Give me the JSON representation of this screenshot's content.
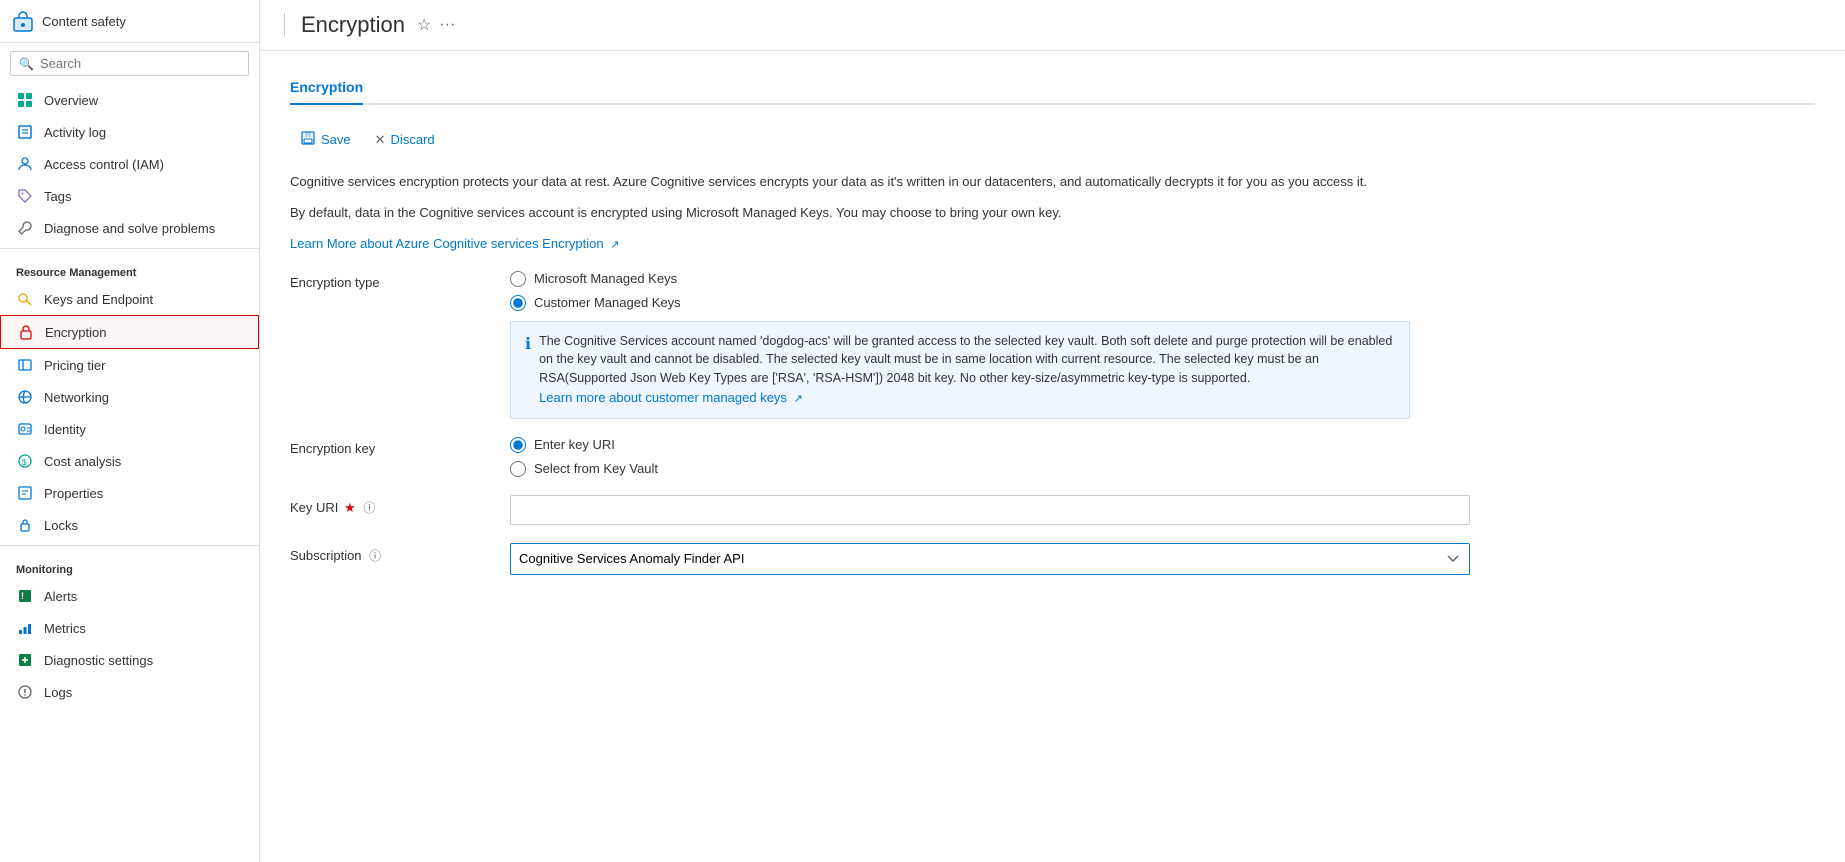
{
  "sidebar": {
    "app_icon_color": "#0078d4",
    "app_name": "Content safety",
    "search_placeholder": "Search",
    "collapse_label": "«",
    "items": [
      {
        "id": "overview",
        "label": "Overview",
        "icon": "grid-icon",
        "icon_color": "#00a693",
        "active": false
      },
      {
        "id": "activity-log",
        "label": "Activity log",
        "icon": "log-icon",
        "icon_color": "#0078d4",
        "active": false
      },
      {
        "id": "access-control",
        "label": "Access control (IAM)",
        "icon": "person-icon",
        "icon_color": "#0078d4",
        "active": false
      },
      {
        "id": "tags",
        "label": "Tags",
        "icon": "tag-icon",
        "icon_color": "#8c6bbf",
        "active": false
      },
      {
        "id": "diagnose",
        "label": "Diagnose and solve problems",
        "icon": "wrench-icon",
        "icon_color": "#666",
        "active": false
      }
    ],
    "sections": [
      {
        "label": "Resource Management",
        "items": [
          {
            "id": "keys-endpoint",
            "label": "Keys and Endpoint",
            "icon": "key-icon",
            "icon_color": "#f0a000",
            "active": false
          },
          {
            "id": "encryption",
            "label": "Encryption",
            "icon": "encryption-icon",
            "icon_color": "#e00000",
            "active": true,
            "highlighted": true
          },
          {
            "id": "pricing-tier",
            "label": "Pricing tier",
            "icon": "pricing-icon",
            "icon_color": "#0078d4",
            "active": false
          },
          {
            "id": "networking",
            "label": "Networking",
            "icon": "network-icon",
            "icon_color": "#0078d4",
            "active": false
          },
          {
            "id": "identity",
            "label": "Identity",
            "icon": "identity-icon",
            "icon_color": "#0078d4",
            "active": false
          },
          {
            "id": "cost-analysis",
            "label": "Cost analysis",
            "icon": "cost-icon",
            "icon_color": "#00a693",
            "active": false
          },
          {
            "id": "properties",
            "label": "Properties",
            "icon": "properties-icon",
            "icon_color": "#0078d4",
            "active": false
          },
          {
            "id": "locks",
            "label": "Locks",
            "icon": "locks-icon",
            "icon_color": "#0078d4",
            "active": false
          }
        ]
      },
      {
        "label": "Monitoring",
        "items": [
          {
            "id": "alerts",
            "label": "Alerts",
            "icon": "alerts-icon",
            "icon_color": "#107c41",
            "active": false
          },
          {
            "id": "metrics",
            "label": "Metrics",
            "icon": "metrics-icon",
            "icon_color": "#0078d4",
            "active": false
          },
          {
            "id": "diagnostic-settings",
            "label": "Diagnostic settings",
            "icon": "diagnostic-icon",
            "icon_color": "#107c41",
            "active": false
          },
          {
            "id": "logs",
            "label": "Logs",
            "icon": "logs-icon",
            "icon_color": "#666",
            "active": false
          }
        ]
      }
    ]
  },
  "header": {
    "divider": "|",
    "title": "Encryption",
    "star_label": "☆",
    "more_label": "···"
  },
  "main": {
    "tab": "Encryption",
    "toolbar": {
      "save_label": "Save",
      "discard_label": "Discard"
    },
    "description1": "Cognitive services encryption protects your data at rest. Azure Cognitive services encrypts your data as it's written in our datacenters, and automatically decrypts it for you as you access it.",
    "description2": "By default, data in the Cognitive services account is encrypted using Microsoft Managed Keys. You may choose to bring your own key.",
    "learn_more_link": "Learn More about Azure Cognitive services Encryption",
    "form": {
      "encryption_type_label": "Encryption type",
      "option_mmk": "Microsoft Managed Keys",
      "option_cmk": "Customer Managed Keys",
      "info_text": "The Cognitive Services account named 'dogdog-acs' will be granted access to the selected key vault. Both soft delete and purge protection will be enabled on the key vault and cannot be disabled. The selected key vault must be in same location with current resource. The selected key must be an RSA(Supported Json Web Key Types are ['RSA', 'RSA-HSM']) 2048 bit key. No other key-size/asymmetric key-type is supported.",
      "learn_more_cmk_link": "Learn more about customer managed keys",
      "encryption_key_label": "Encryption key",
      "option_enter_key_uri": "Enter key URI",
      "option_select_key_vault": "Select from Key Vault",
      "key_uri_label": "Key URI",
      "key_uri_required": "★",
      "key_uri_placeholder": "",
      "subscription_label": "Subscription",
      "subscription_value": "Cognitive Services Anomaly Finder API",
      "subscription_options": [
        "Cognitive Services Anomaly Finder API"
      ]
    }
  }
}
